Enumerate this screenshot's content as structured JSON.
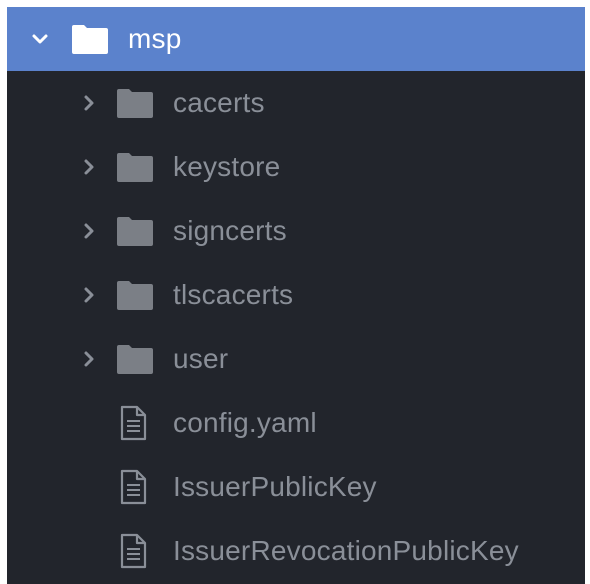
{
  "tree": {
    "root": {
      "label": "msp",
      "icon": "folder-icon",
      "expanded": true,
      "selected": true
    },
    "children": [
      {
        "label": "cacerts",
        "type": "folder",
        "icon": "folder-icon",
        "expanded": false
      },
      {
        "label": "keystore",
        "type": "folder",
        "icon": "folder-icon",
        "expanded": false
      },
      {
        "label": "signcerts",
        "type": "folder",
        "icon": "folder-icon",
        "expanded": false
      },
      {
        "label": "tlscacerts",
        "type": "folder",
        "icon": "folder-icon",
        "expanded": false
      },
      {
        "label": "user",
        "type": "folder",
        "icon": "folder-icon",
        "expanded": false
      },
      {
        "label": "config.yaml",
        "type": "file",
        "icon": "file-icon"
      },
      {
        "label": "IssuerPublicKey",
        "type": "file",
        "icon": "file-icon"
      },
      {
        "label": "IssuerRevocationPublicKey",
        "type": "file",
        "icon": "file-icon"
      }
    ]
  },
  "colors": {
    "panel_background": "#22252c",
    "selected_row_background": "#5b82cc",
    "item_text": "#8a8f98",
    "selected_text": "#ffffff",
    "folder_icon": "#7b7f86",
    "file_icon": "#8a8f98"
  }
}
